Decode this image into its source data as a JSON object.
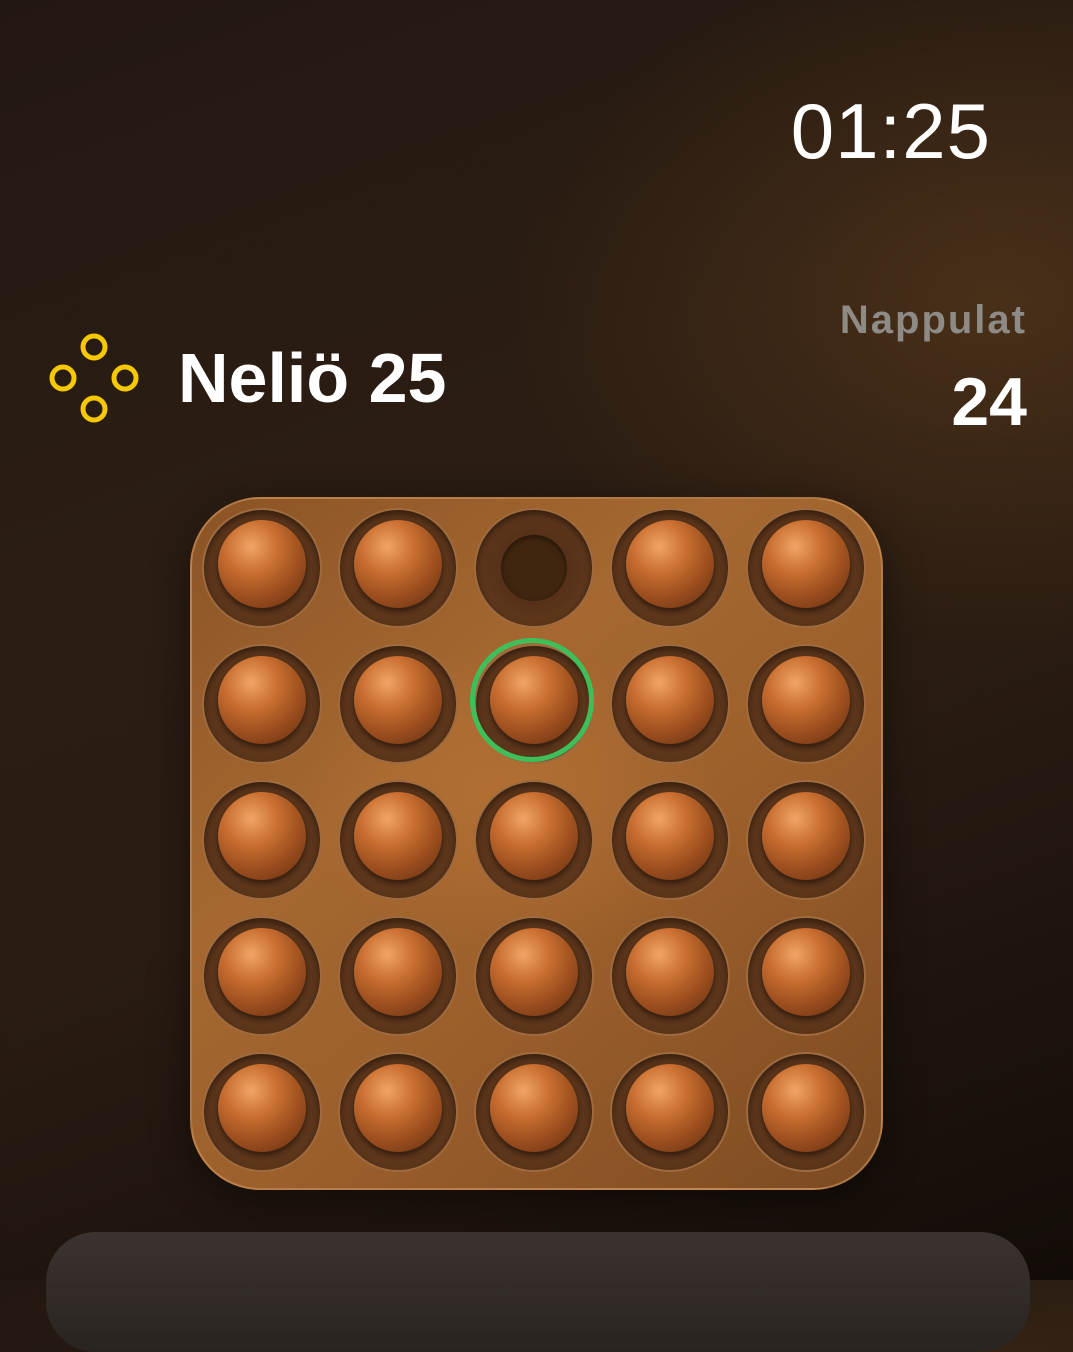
{
  "status_bar": {
    "time": "01:25"
  },
  "game": {
    "mode_icon": "four-rings-icon",
    "title": "Neliö 25",
    "pegs_label": "Nappulat",
    "pegs_count": "24"
  },
  "board": {
    "rows": 5,
    "cols": 5,
    "empty": [
      [
        0,
        2
      ]
    ],
    "selected": [
      1,
      2
    ]
  },
  "colors": {
    "accent": "#f5c800",
    "selection": "#3fbf5a",
    "board": "#a66830",
    "peg": "#c96f31"
  }
}
